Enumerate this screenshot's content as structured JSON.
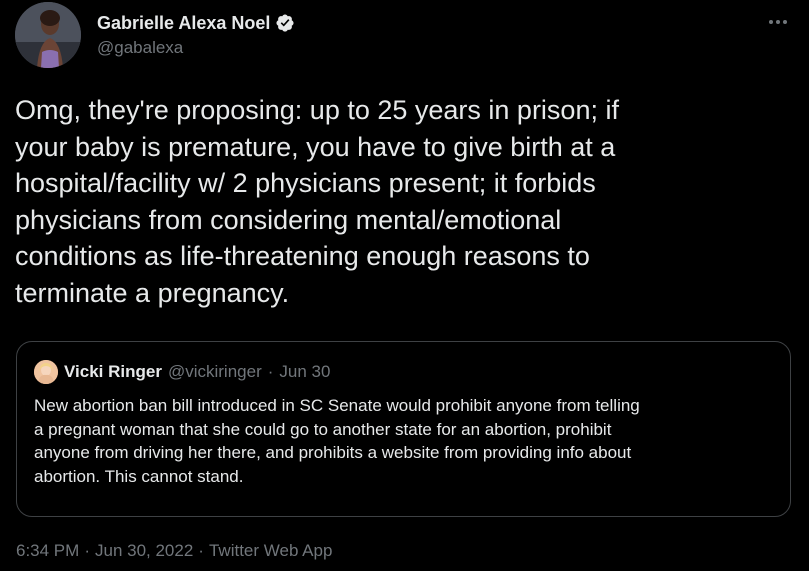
{
  "author": {
    "name": "Gabrielle Alexa Noel",
    "handle": "@gabalexa",
    "verified": true
  },
  "tweet": {
    "text": "Omg, they're proposing: up to 25 years in prison; if\nyour baby is premature, you have to give birth at a\nhospital/facility w/ 2 physicians present; it forbids\nphysicians from considering mental/emotional\nconditions as life-threatening enough reasons to\nterminate a pregnancy."
  },
  "quoted_tweet": {
    "name": "Vicki Ringer",
    "handle": "@vickiringer",
    "separator": "·",
    "date": "Jun 30",
    "text": "New abortion ban bill introduced in SC Senate would prohibit anyone from telling\na pregnant woman that she could go to another state for an abortion, prohibit\nanyone from driving her there, and prohibits a website from providing info about\nabortion. This cannot stand."
  },
  "meta": {
    "time": "6:34 PM",
    "sep1": "·",
    "date": "Jun 30, 2022",
    "sep2": "·",
    "source": "Twitter Web App"
  },
  "icons": {
    "verified": "verified-badge-icon",
    "more": "more-options-icon"
  },
  "colors": {
    "background": "#000000",
    "primary_text": "#e7e9ea",
    "secondary_text": "#71767b",
    "border": "#3e4144",
    "verified_badge": "#e7e9ea"
  }
}
